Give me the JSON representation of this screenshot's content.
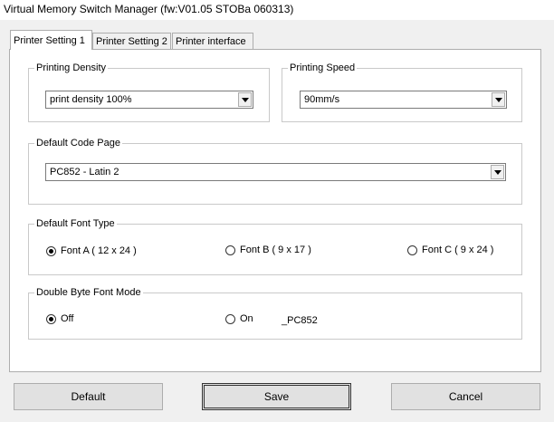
{
  "window": {
    "title": "Virtual Memory Switch Manager  (fw:V01.05 STOBa 060313)"
  },
  "tabs": [
    {
      "label": "Printer Setting 1"
    },
    {
      "label": "Printer Setting 2"
    },
    {
      "label": "Printer interface"
    }
  ],
  "printing_density": {
    "label": "Printing Density",
    "value": "print density 100%"
  },
  "printing_speed": {
    "label": "Printing Speed",
    "value": "90mm/s"
  },
  "code_page": {
    "label": "Default Code Page",
    "value": "PC852 - Latin 2"
  },
  "font_type": {
    "label": "Default Font Type",
    "options": [
      {
        "label": "Font A ( 12 x 24 )",
        "checked": true
      },
      {
        "label": "Font B ( 9 x 17 )",
        "checked": false
      },
      {
        "label": "Font C ( 9 x 24 )",
        "checked": false
      }
    ]
  },
  "double_byte": {
    "label": "Double Byte Font Mode",
    "options": [
      {
        "label": "Off",
        "checked": true
      },
      {
        "label": "On",
        "checked": false
      }
    ],
    "codepage_text": "_PC852"
  },
  "buttons": {
    "default": "Default",
    "save": "Save",
    "cancel": "Cancel"
  }
}
